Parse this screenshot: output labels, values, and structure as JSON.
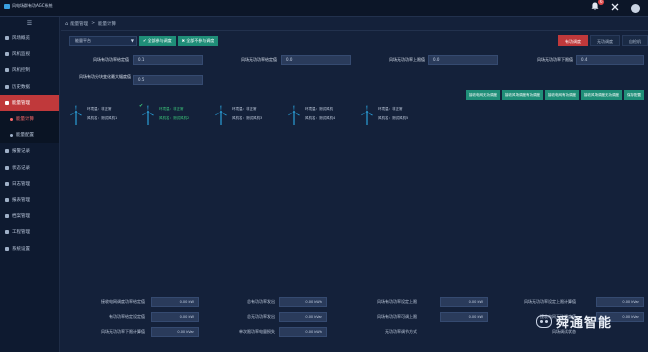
{
  "app": {
    "title": "风电场群有功AGC系统"
  },
  "topbar": {
    "badge_count": "6"
  },
  "sidebar": {
    "toggle_icon": "menu-icon",
    "items": [
      {
        "label": "风场概览",
        "icon": "home-icon"
      },
      {
        "label": "风机监视",
        "icon": "monitor-icon"
      },
      {
        "label": "风机控制",
        "icon": "control-icon"
      },
      {
        "label": "历史数据",
        "icon": "history-icon"
      },
      {
        "label": "能量管理",
        "icon": "energy-icon"
      },
      {
        "label": "能量计算",
        "icon": "calc-icon"
      },
      {
        "label": "能量配置",
        "icon": "config-icon"
      },
      {
        "label": "报警记录",
        "icon": "alarm-icon"
      },
      {
        "label": "状态记录",
        "icon": "status-icon"
      },
      {
        "label": "日志管理",
        "icon": "log-icon"
      },
      {
        "label": "报表管理",
        "icon": "report-icon"
      },
      {
        "label": "档案管理",
        "icon": "archive-icon"
      },
      {
        "label": "工程管理",
        "icon": "project-icon"
      },
      {
        "label": "系统设置",
        "icon": "settings-icon"
      }
    ]
  },
  "breadcrumb": {
    "parent": "能量管理",
    "separator": ">",
    "current": "能量计算"
  },
  "tabs": [
    {
      "label": "有功调度"
    },
    {
      "label": "无功调度"
    },
    {
      "label": "自检机"
    }
  ],
  "toolbar": {
    "select_value": "能量平台",
    "btn_all_join": "✔ 全部参与调度",
    "btn_all_exit": "✖ 全部不参与调度"
  },
  "form": {
    "row1": [
      {
        "label": "风场有功功率给定值",
        "value": "0.1"
      },
      {
        "label": "风场无功功率给定值",
        "value": "0.0"
      },
      {
        "label": "风场无功功率上限值",
        "value": "0.0"
      },
      {
        "label": "风场无功功率下限值",
        "value": "0.4"
      }
    ],
    "row2": {
      "label": "风场有功分块变化最大幅度值",
      "value": "0.5"
    }
  },
  "actions": [
    "接收电网无功调度",
    "接收风场调度有功调度",
    "接收电网有功调度",
    "接收风场调度无功调度",
    "保存配置"
  ],
  "turbines": [
    {
      "state": "环境温：非正常",
      "name": "风机名：测试风机1",
      "selected": false
    },
    {
      "state": "环境温：非正常",
      "name": "风机名：测试风机2",
      "selected": true
    },
    {
      "state": "环境温：非正常",
      "name": "风机名：测试风机3",
      "selected": false
    },
    {
      "state": "环境温：测试风机",
      "name": "风机名：测试风机4",
      "selected": false
    },
    {
      "state": "环境温：非正常",
      "name": "风机名：测试风机5",
      "selected": false
    }
  ],
  "summary": {
    "rows": [
      [
        {
          "label": "接收电网调度功率给定值",
          "value": "0.00 kW"
        },
        {
          "label": "总有功功率发出",
          "value": "0.00 kWh"
        },
        {
          "label": "风场有功功率设定上限",
          "value": "0.00 kW"
        },
        {
          "label": "风场无功功率设定上限计算值",
          "value": "0.00 kVar"
        }
      ],
      [
        {
          "label": "有功功率给定设定值",
          "value": "0.00 kW"
        },
        {
          "label": "总无功功率发出",
          "value": "0.00 kVar"
        },
        {
          "label": "风场有功功率可调上限",
          "value": "0.00 kW"
        },
        {
          "label": "接收电网无功调度值",
          "value": "0.00 kVar"
        }
      ],
      [
        {
          "label": "风场无功功率下限计算值",
          "value": "0.00 kVar"
        },
        {
          "label": "单次限功率电量损失",
          "value": "0.00 kWh"
        },
        {
          "label": "无功功率调节方式",
          "value": ""
        },
        {
          "label": "风场调试状态",
          "value": ""
        }
      ]
    ]
  },
  "watermark": {
    "text": "舜通智能"
  }
}
